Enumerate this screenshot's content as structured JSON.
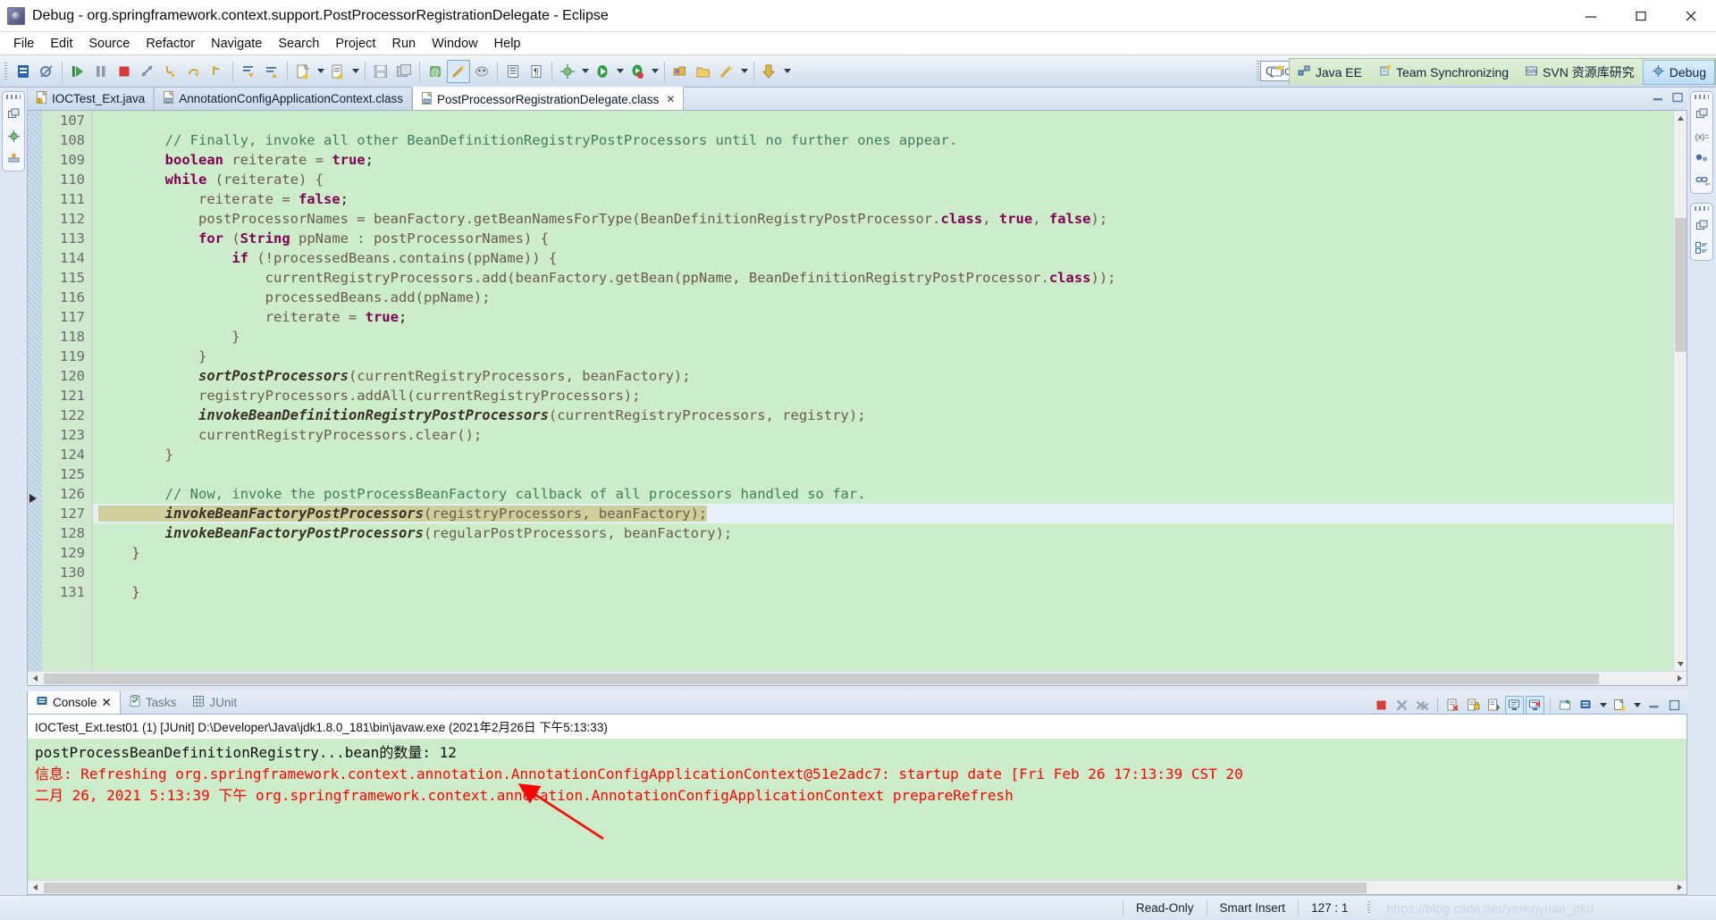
{
  "window": {
    "title": "Debug - org.springframework.context.support.PostProcessorRegistrationDelegate - Eclipse",
    "app_icon": "eclipse-icon",
    "minimize": "minimize-button",
    "maximize": "maximize-button",
    "close": "close-button"
  },
  "menubar": {
    "items": [
      {
        "label": "File"
      },
      {
        "label": "Edit"
      },
      {
        "label": "Source"
      },
      {
        "label": "Refactor"
      },
      {
        "label": "Navigate"
      },
      {
        "label": "Search"
      },
      {
        "label": "Project"
      },
      {
        "label": "Run"
      },
      {
        "label": "Window"
      },
      {
        "label": "Help"
      }
    ]
  },
  "toolbar": {
    "quick_access": "Quick Access",
    "perspectives": [
      {
        "label": "Java EE",
        "selected": false,
        "icon": "javaee-perspective-icon"
      },
      {
        "label": "Team Synchronizing",
        "selected": false,
        "icon": "team-sync-perspective-icon"
      },
      {
        "label": "SVN 资源库研究",
        "selected": false,
        "icon": "svn-perspective-icon"
      },
      {
        "label": "Debug",
        "selected": true,
        "icon": "debug-perspective-icon"
      }
    ],
    "open_perspective": "open-perspective-button"
  },
  "editor": {
    "tabs": [
      {
        "label": "IOCTest_Ext.java",
        "selected": false,
        "icon": "java-file-icon",
        "closable": false
      },
      {
        "label": "AnnotationConfigApplicationContext.class",
        "selected": false,
        "icon": "class-file-icon",
        "closable": false
      },
      {
        "label": "PostProcessorRegistrationDelegate.class",
        "selected": true,
        "icon": "class-file-icon",
        "closable": true
      }
    ],
    "first_visible_line": 107,
    "current_line": 127,
    "lines": [
      {
        "n": "107",
        "tokens": []
      },
      {
        "n": "108",
        "tokens": [
          {
            "t": "        ",
            "c": "pl"
          },
          {
            "t": "// Finally, invoke all other BeanDefinitionRegistryPostProcessors until no further ones appear.",
            "c": "cm"
          }
        ]
      },
      {
        "n": "109",
        "tokens": [
          {
            "t": "        ",
            "c": "pl"
          },
          {
            "t": "boolean",
            "c": "k"
          },
          {
            "t": " reiterate = ",
            "c": "id"
          },
          {
            "t": "true",
            "c": "k"
          },
          {
            "t": ";",
            "c": "pl"
          }
        ]
      },
      {
        "n": "110",
        "tokens": [
          {
            "t": "        ",
            "c": "pl"
          },
          {
            "t": "while",
            "c": "k"
          },
          {
            "t": " (reiterate) {",
            "c": "id"
          }
        ]
      },
      {
        "n": "111",
        "tokens": [
          {
            "t": "            reiterate = ",
            "c": "id"
          },
          {
            "t": "false",
            "c": "k"
          },
          {
            "t": ";",
            "c": "pl"
          }
        ]
      },
      {
        "n": "112",
        "tokens": [
          {
            "t": "            postProcessorNames = beanFactory.getBeanNamesForType(BeanDefinitionRegistryPostProcessor.",
            "c": "id"
          },
          {
            "t": "class",
            "c": "k"
          },
          {
            "t": ", ",
            "c": "id"
          },
          {
            "t": "true",
            "c": "k"
          },
          {
            "t": ", ",
            "c": "id"
          },
          {
            "t": "false",
            "c": "k"
          },
          {
            "t": ");",
            "c": "id"
          }
        ]
      },
      {
        "n": "113",
        "tokens": [
          {
            "t": "            ",
            "c": "pl"
          },
          {
            "t": "for",
            "c": "k"
          },
          {
            "t": " (",
            "c": "id"
          },
          {
            "t": "String",
            "c": "k"
          },
          {
            "t": " ppName : postProcessorNames) {",
            "c": "id"
          }
        ]
      },
      {
        "n": "114",
        "tokens": [
          {
            "t": "                ",
            "c": "pl"
          },
          {
            "t": "if",
            "c": "k"
          },
          {
            "t": " (!processedBeans.contains(ppName)) {",
            "c": "id"
          }
        ]
      },
      {
        "n": "115",
        "tokens": [
          {
            "t": "                    currentRegistryProcessors.add(beanFactory.getBean(ppName, BeanDefinitionRegistryPostProcessor.",
            "c": "id"
          },
          {
            "t": "class",
            "c": "k"
          },
          {
            "t": "));",
            "c": "id"
          }
        ]
      },
      {
        "n": "116",
        "tokens": [
          {
            "t": "                    processedBeans.add(ppName);",
            "c": "id"
          }
        ]
      },
      {
        "n": "117",
        "tokens": [
          {
            "t": "                    reiterate = ",
            "c": "id"
          },
          {
            "t": "true",
            "c": "k"
          },
          {
            "t": ";",
            "c": "pl"
          }
        ]
      },
      {
        "n": "118",
        "tokens": [
          {
            "t": "                }",
            "c": "id"
          }
        ]
      },
      {
        "n": "119",
        "tokens": [
          {
            "t": "            }",
            "c": "id"
          }
        ]
      },
      {
        "n": "120",
        "tokens": [
          {
            "t": "            ",
            "c": "pl"
          },
          {
            "t": "sortPostProcessors",
            "c": "it"
          },
          {
            "t": "(currentRegistryProcessors, beanFactory);",
            "c": "id"
          }
        ]
      },
      {
        "n": "121",
        "tokens": [
          {
            "t": "            registryProcessors.addAll(currentRegistryProcessors);",
            "c": "id"
          }
        ]
      },
      {
        "n": "122",
        "tokens": [
          {
            "t": "            ",
            "c": "pl"
          },
          {
            "t": "invokeBeanDefinitionRegistryPostProcessors",
            "c": "it"
          },
          {
            "t": "(currentRegistryProcessors, registry);",
            "c": "id"
          }
        ]
      },
      {
        "n": "123",
        "tokens": [
          {
            "t": "            currentRegistryProcessors.clear();",
            "c": "id"
          }
        ]
      },
      {
        "n": "124",
        "tokens": [
          {
            "t": "        }",
            "c": "id"
          }
        ]
      },
      {
        "n": "125",
        "tokens": []
      },
      {
        "n": "126",
        "tokens": [
          {
            "t": "        ",
            "c": "pl"
          },
          {
            "t": "// Now, invoke the postProcessBeanFactory callback of all processors handled so far.",
            "c": "cm"
          }
        ]
      },
      {
        "n": "127",
        "current": true,
        "tokens": [
          {
            "t": "        ",
            "c": "pl"
          },
          {
            "t": "invokeBeanFactoryPostProcessors",
            "c": "it"
          },
          {
            "t": "(registryProcessors, beanFactory);",
            "c": "id"
          }
        ]
      },
      {
        "n": "128",
        "tokens": [
          {
            "t": "        ",
            "c": "pl"
          },
          {
            "t": "invokeBeanFactoryPostProcessors",
            "c": "it"
          },
          {
            "t": "(regularPostProcessors, beanFactory);",
            "c": "id"
          }
        ]
      },
      {
        "n": "129",
        "tokens": [
          {
            "t": "    }",
            "c": "id"
          }
        ]
      },
      {
        "n": "130",
        "tokens": []
      },
      {
        "n": "131",
        "tokens": [
          {
            "t": "    }",
            "c": "id"
          }
        ]
      }
    ]
  },
  "console": {
    "tabs": [
      {
        "label": "Console",
        "selected": true,
        "icon": "console-icon",
        "closable": true
      },
      {
        "label": "Tasks",
        "selected": false,
        "icon": "tasks-icon",
        "closable": false
      },
      {
        "label": "JUnit",
        "selected": false,
        "icon": "junit-icon",
        "closable": false
      }
    ],
    "header": "IOCTest_Ext.test01 (1) [JUnit] D:\\Developer\\Java\\jdk1.8.0_181\\bin\\javaw.exe (2021年2月26日 下午5:13:33)",
    "output": [
      {
        "text": "二月 26, 2021 5:13:39 下午 org.springframework.context.annotation.AnnotationConfigApplicationContext prepareRefresh",
        "stream": "err"
      },
      {
        "text": "信息: Refreshing org.springframework.context.annotation.AnnotationConfigApplicationContext@51e2adc7: startup date [Fri Feb 26 17:13:39 CST 20",
        "stream": "err"
      },
      {
        "text": "postProcessBeanDefinitionRegistry...bean的数量: 12",
        "stream": "out"
      }
    ],
    "tools": [
      {
        "name": "terminate-button",
        "enabled": true
      },
      {
        "name": "remove-launch-button",
        "enabled": false
      },
      {
        "name": "remove-all-terminated-button",
        "enabled": false
      },
      {
        "name": "clear-console-button",
        "enabled": true
      },
      {
        "name": "scroll-lock-button",
        "enabled": true
      },
      {
        "name": "save-output-button",
        "enabled": true
      },
      {
        "name": "show-console-on-output-button",
        "enabled": true,
        "toggled": true
      },
      {
        "name": "show-console-on-error-button",
        "enabled": true,
        "toggled": true
      },
      {
        "name": "pin-console-button",
        "enabled": true
      },
      {
        "name": "display-selected-console-button",
        "enabled": true
      },
      {
        "name": "open-console-button",
        "enabled": true
      },
      {
        "name": "minimize-view-button",
        "enabled": true
      },
      {
        "name": "maximize-view-button",
        "enabled": true
      }
    ]
  },
  "annotation": {
    "arrow_color": "#ff0000",
    "arrow_name": "red-annotation-arrow"
  },
  "statusbar": {
    "read_only": "Read-Only",
    "insert_mode": "Smart Insert",
    "cursor_position": "127 : 1",
    "watermark": "https://blog.csdn.net/yerenyuan_pku"
  },
  "colors": {
    "code_bg": "#ccecca",
    "gutter_bg": "#cfe9cf",
    "current_line": "#e8f1fb",
    "selection": "#cdd09b",
    "console_bg": "#ccecca",
    "error_text": "#ff0000",
    "keyword": "#7f0055",
    "comment": "#3f7f5f"
  }
}
